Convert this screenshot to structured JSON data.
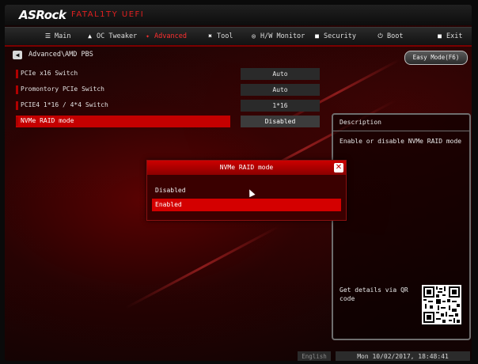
{
  "brand": {
    "name": "ASRock",
    "sub": "FATAL1TY UEFI"
  },
  "nav": [
    {
      "label": "Main",
      "icon": "list-icon",
      "glyph": "☰"
    },
    {
      "label": "OC Tweaker",
      "icon": "rocket-icon",
      "glyph": "▲"
    },
    {
      "label": "Advanced",
      "icon": "advanced-icon",
      "glyph": "✦",
      "active": true
    },
    {
      "label": "Tool",
      "icon": "tool-icon",
      "glyph": "✖"
    },
    {
      "label": "H/W Monitor",
      "icon": "monitor-icon",
      "glyph": "◎"
    },
    {
      "label": "Security",
      "icon": "shield-icon",
      "glyph": "■"
    },
    {
      "label": "Boot",
      "icon": "power-icon",
      "glyph": "⏻"
    },
    {
      "label": "Exit",
      "icon": "exit-icon",
      "glyph": "■"
    }
  ],
  "breadcrumb": "Advanced\\AMD PBS",
  "easy_mode": "Easy Mode(F6)",
  "settings": [
    {
      "label": "PCIe x16 Switch",
      "value": "Auto"
    },
    {
      "label": "Promontory PCIe Switch",
      "value": "Auto"
    },
    {
      "label": "PCIE4 1*16 / 4*4 Switch",
      "value": "1*16"
    },
    {
      "label": "NVMe RAID mode",
      "value": "Disabled",
      "selected": true
    }
  ],
  "description": {
    "title": "Description",
    "text": "Enable or disable NVMe RAID mode",
    "qr_text": "Get details via QR code"
  },
  "popup": {
    "title": "NVMe RAID mode",
    "options": [
      "Disabled",
      "Enabled"
    ],
    "selected_index": 1
  },
  "footer": {
    "language": "English",
    "datetime": "Mon 10/02/2017, 18:48:41"
  },
  "colors": {
    "accent": "#c40000",
    "active_nav": "#ff3030"
  }
}
